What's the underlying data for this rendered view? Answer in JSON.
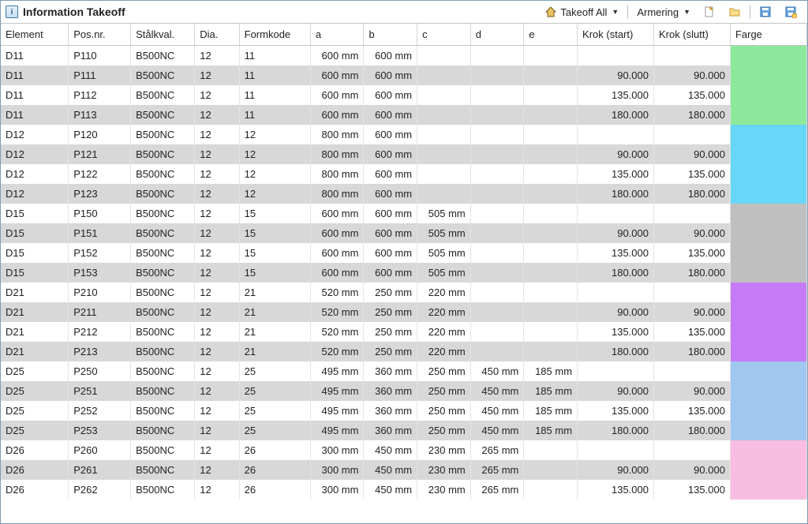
{
  "title": "Information Takeoff",
  "toolbar": {
    "takeoff_label": "Takeoff All",
    "armering_label": "Armering"
  },
  "headers": {
    "element": "Element",
    "posnr": "Pos.nr.",
    "stalkval": "Stålkval.",
    "dia": "Dia.",
    "formkode": "Formkode",
    "a": "a",
    "b": "b",
    "c": "c",
    "d": "d",
    "e": "e",
    "krok_start": "Krok (start)",
    "krok_slutt": "Krok (slutt)",
    "farge": "Farge"
  },
  "colors": {
    "D11": "#8de89b",
    "D12": "#68d6f7",
    "D15": "#bfbfbf",
    "D21": "#c77af5",
    "D25": "#9fc7ef",
    "D26": "#f8bde0"
  },
  "rows": [
    {
      "element": "D11",
      "posnr": "P110",
      "stal": "B500NC",
      "dia": "12",
      "formkode": "11",
      "a": "600 mm",
      "b": "600 mm",
      "c": "",
      "d": "",
      "e": "",
      "ks": "",
      "ke": "",
      "farge": "D11"
    },
    {
      "element": "D11",
      "posnr": "P111",
      "stal": "B500NC",
      "dia": "12",
      "formkode": "11",
      "a": "600 mm",
      "b": "600 mm",
      "c": "",
      "d": "",
      "e": "",
      "ks": "90.000",
      "ke": "90.000",
      "farge": "D11"
    },
    {
      "element": "D11",
      "posnr": "P112",
      "stal": "B500NC",
      "dia": "12",
      "formkode": "11",
      "a": "600 mm",
      "b": "600 mm",
      "c": "",
      "d": "",
      "e": "",
      "ks": "135.000",
      "ke": "135.000",
      "farge": "D11"
    },
    {
      "element": "D11",
      "posnr": "P113",
      "stal": "B500NC",
      "dia": "12",
      "formkode": "11",
      "a": "600 mm",
      "b": "600 mm",
      "c": "",
      "d": "",
      "e": "",
      "ks": "180.000",
      "ke": "180.000",
      "farge": "D11"
    },
    {
      "element": "D12",
      "posnr": "P120",
      "stal": "B500NC",
      "dia": "12",
      "formkode": "12",
      "a": "800 mm",
      "b": "600 mm",
      "c": "",
      "d": "",
      "e": "",
      "ks": "",
      "ke": "",
      "farge": "D12"
    },
    {
      "element": "D12",
      "posnr": "P121",
      "stal": "B500NC",
      "dia": "12",
      "formkode": "12",
      "a": "800 mm",
      "b": "600 mm",
      "c": "",
      "d": "",
      "e": "",
      "ks": "90.000",
      "ke": "90.000",
      "farge": "D12"
    },
    {
      "element": "D12",
      "posnr": "P122",
      "stal": "B500NC",
      "dia": "12",
      "formkode": "12",
      "a": "800 mm",
      "b": "600 mm",
      "c": "",
      "d": "",
      "e": "",
      "ks": "135.000",
      "ke": "135.000",
      "farge": "D12"
    },
    {
      "element": "D12",
      "posnr": "P123",
      "stal": "B500NC",
      "dia": "12",
      "formkode": "12",
      "a": "800 mm",
      "b": "600 mm",
      "c": "",
      "d": "",
      "e": "",
      "ks": "180.000",
      "ke": "180.000",
      "farge": "D12"
    },
    {
      "element": "D15",
      "posnr": "P150",
      "stal": "B500NC",
      "dia": "12",
      "formkode": "15",
      "a": "600 mm",
      "b": "600 mm",
      "c": "505 mm",
      "d": "",
      "e": "",
      "ks": "",
      "ke": "",
      "farge": "D15"
    },
    {
      "element": "D15",
      "posnr": "P151",
      "stal": "B500NC",
      "dia": "12",
      "formkode": "15",
      "a": "600 mm",
      "b": "600 mm",
      "c": "505 mm",
      "d": "",
      "e": "",
      "ks": "90.000",
      "ke": "90.000",
      "farge": "D15"
    },
    {
      "element": "D15",
      "posnr": "P152",
      "stal": "B500NC",
      "dia": "12",
      "formkode": "15",
      "a": "600 mm",
      "b": "600 mm",
      "c": "505 mm",
      "d": "",
      "e": "",
      "ks": "135.000",
      "ke": "135.000",
      "farge": "D15"
    },
    {
      "element": "D15",
      "posnr": "P153",
      "stal": "B500NC",
      "dia": "12",
      "formkode": "15",
      "a": "600 mm",
      "b": "600 mm",
      "c": "505 mm",
      "d": "",
      "e": "",
      "ks": "180.000",
      "ke": "180.000",
      "farge": "D15"
    },
    {
      "element": "D21",
      "posnr": "P210",
      "stal": "B500NC",
      "dia": "12",
      "formkode": "21",
      "a": "520 mm",
      "b": "250 mm",
      "c": "220 mm",
      "d": "",
      "e": "",
      "ks": "",
      "ke": "",
      "farge": "D21"
    },
    {
      "element": "D21",
      "posnr": "P211",
      "stal": "B500NC",
      "dia": "12",
      "formkode": "21",
      "a": "520 mm",
      "b": "250 mm",
      "c": "220 mm",
      "d": "",
      "e": "",
      "ks": "90.000",
      "ke": "90.000",
      "farge": "D21"
    },
    {
      "element": "D21",
      "posnr": "P212",
      "stal": "B500NC",
      "dia": "12",
      "formkode": "21",
      "a": "520 mm",
      "b": "250 mm",
      "c": "220 mm",
      "d": "",
      "e": "",
      "ks": "135.000",
      "ke": "135.000",
      "farge": "D21"
    },
    {
      "element": "D21",
      "posnr": "P213",
      "stal": "B500NC",
      "dia": "12",
      "formkode": "21",
      "a": "520 mm",
      "b": "250 mm",
      "c": "220 mm",
      "d": "",
      "e": "",
      "ks": "180.000",
      "ke": "180.000",
      "farge": "D21"
    },
    {
      "element": "D25",
      "posnr": "P250",
      "stal": "B500NC",
      "dia": "12",
      "formkode": "25",
      "a": "495 mm",
      "b": "360 mm",
      "c": "250 mm",
      "d": "450 mm",
      "e": "185 mm",
      "ks": "",
      "ke": "",
      "farge": "D25"
    },
    {
      "element": "D25",
      "posnr": "P251",
      "stal": "B500NC",
      "dia": "12",
      "formkode": "25",
      "a": "495 mm",
      "b": "360 mm",
      "c": "250 mm",
      "d": "450 mm",
      "e": "185 mm",
      "ks": "90.000",
      "ke": "90.000",
      "farge": "D25"
    },
    {
      "element": "D25",
      "posnr": "P252",
      "stal": "B500NC",
      "dia": "12",
      "formkode": "25",
      "a": "495 mm",
      "b": "360 mm",
      "c": "250 mm",
      "d": "450 mm",
      "e": "185 mm",
      "ks": "135.000",
      "ke": "135.000",
      "farge": "D25"
    },
    {
      "element": "D25",
      "posnr": "P253",
      "stal": "B500NC",
      "dia": "12",
      "formkode": "25",
      "a": "495 mm",
      "b": "360 mm",
      "c": "250 mm",
      "d": "450 mm",
      "e": "185 mm",
      "ks": "180.000",
      "ke": "180.000",
      "farge": "D25"
    },
    {
      "element": "D26",
      "posnr": "P260",
      "stal": "B500NC",
      "dia": "12",
      "formkode": "26",
      "a": "300 mm",
      "b": "450 mm",
      "c": "230 mm",
      "d": "265 mm",
      "e": "",
      "ks": "",
      "ke": "",
      "farge": "D26"
    },
    {
      "element": "D26",
      "posnr": "P261",
      "stal": "B500NC",
      "dia": "12",
      "formkode": "26",
      "a": "300 mm",
      "b": "450 mm",
      "c": "230 mm",
      "d": "265 mm",
      "e": "",
      "ks": "90.000",
      "ke": "90.000",
      "farge": "D26"
    },
    {
      "element": "D26",
      "posnr": "P262",
      "stal": "B500NC",
      "dia": "12",
      "formkode": "26",
      "a": "300 mm",
      "b": "450 mm",
      "c": "230 mm",
      "d": "265 mm",
      "e": "",
      "ks": "135.000",
      "ke": "135.000",
      "farge": "D26"
    }
  ]
}
